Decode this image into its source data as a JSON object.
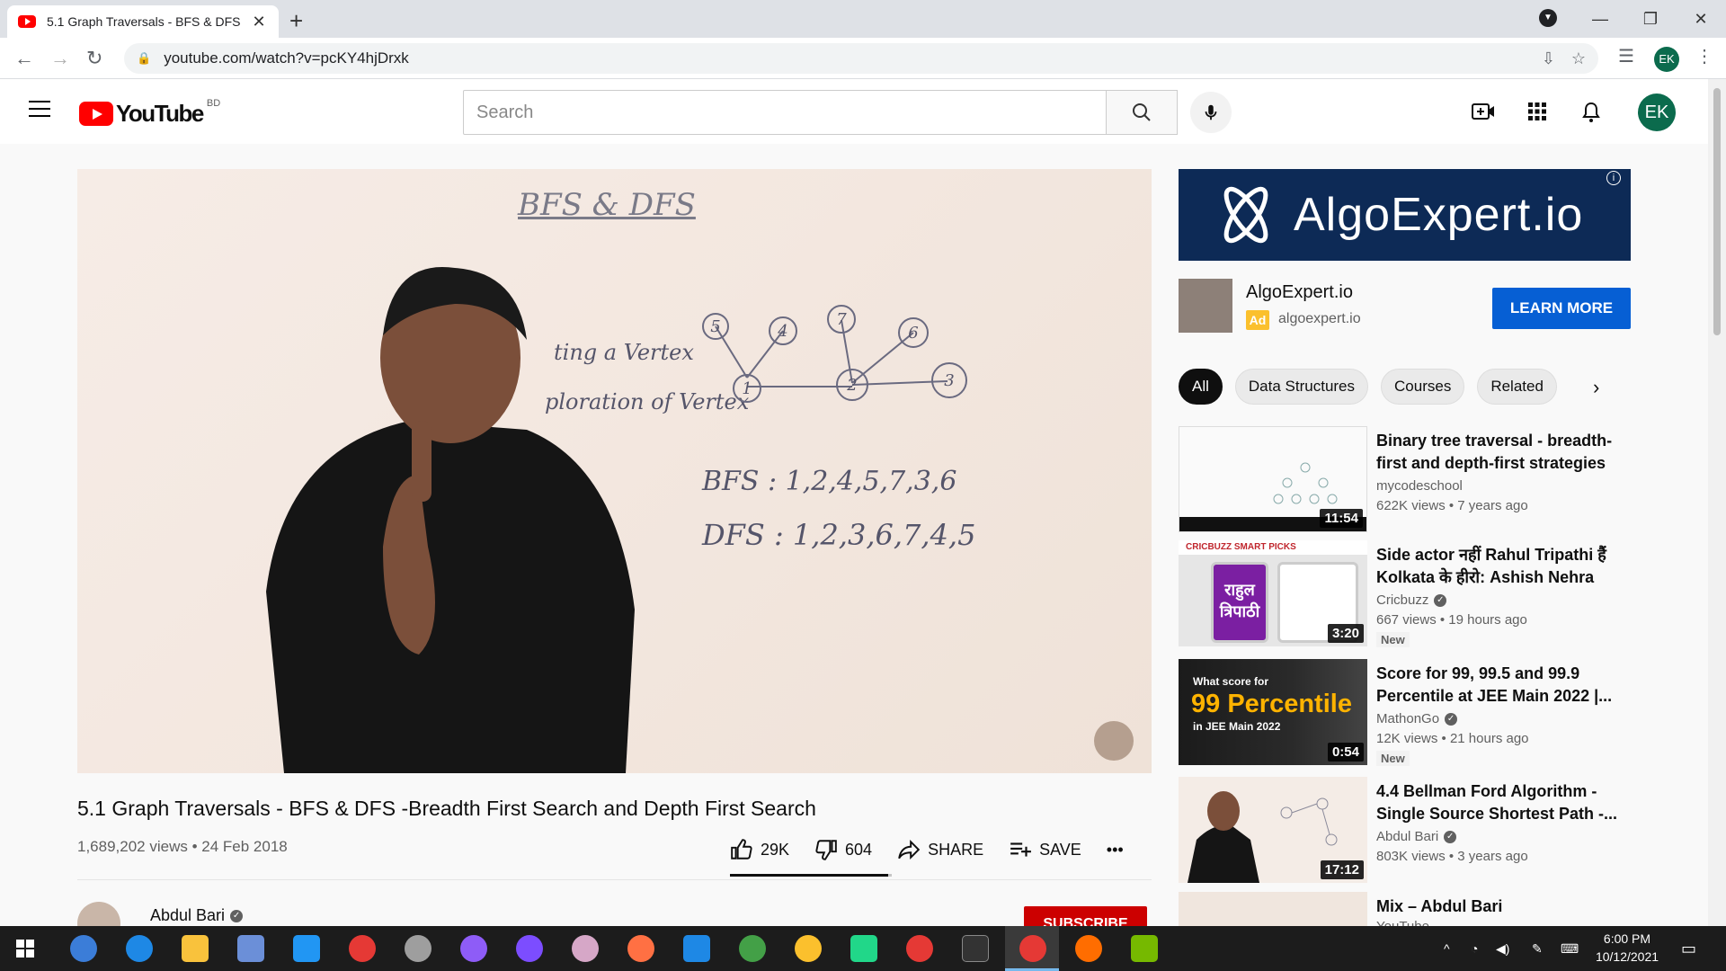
{
  "browser": {
    "tab_title": "5.1 Graph Traversals - BFS & DFS",
    "tab_close": "✕",
    "new_tab": "+",
    "url": "youtube.com/watch?v=pcKY4hjDrxk",
    "profile_initials": "EK",
    "window_controls": [
      "—",
      "❐",
      "✕"
    ]
  },
  "youtube": {
    "logo_text": "YouTube",
    "country_code": "BD",
    "search_placeholder": "Search",
    "user_initials": "EK"
  },
  "video": {
    "board_title": "BFS & DFS",
    "board_lines": [
      "ting a Vertex",
      "ploration of Vertex"
    ],
    "bfs_line": "BFS : 1,2,4,5,7,3,6",
    "dfs_line": "DFS : 1,2,3,6,7,4,5",
    "graph_nodes": [
      "5",
      "4",
      "7",
      "6",
      "1",
      "2",
      "3"
    ],
    "title": "5.1 Graph Traversals - BFS & DFS -Breadth First Search and Depth First Search",
    "views": "1,689,202 views",
    "date": "24 Feb 2018",
    "likes": "29K",
    "dislikes": "604",
    "like_ratio": 0.979,
    "share_label": "SHARE",
    "save_label": "SAVE",
    "more_label": "•••",
    "channel_name": "Abdul Bari",
    "subscribe_label": "SUBSCRIBE"
  },
  "ad": {
    "banner_text": "AlgoExpert.io",
    "title": "AlgoExpert.io",
    "badge": "Ad",
    "url": "algoexpert.io",
    "cta": "LEARN MORE",
    "info": "i"
  },
  "chips": [
    "All",
    "Data Structures",
    "Courses",
    "Related"
  ],
  "recommendations": [
    {
      "title": "Binary tree traversal - breadth-first and depth-first strategies",
      "channel": "mycodeschool",
      "meta": "622K views • 7 years ago",
      "duration": "11:54",
      "verified": false,
      "badge": ""
    },
    {
      "title": "Side actor नहीं Rahul Tripathi हैं Kolkata के हीरो: Ashish Nehra",
      "channel": "Cricbuzz",
      "meta": "667 views • 19 hours ago",
      "duration": "3:20",
      "verified": true,
      "badge": "New"
    },
    {
      "title": "Score for 99, 99.5 and 99.9 Percentile at JEE Main 2022 |...",
      "channel": "MathonGo",
      "meta": "12K views • 21 hours ago",
      "duration": "0:54",
      "verified": true,
      "badge": "New"
    },
    {
      "title": "4.4 Bellman Ford Algorithm - Single Source Shortest Path -...",
      "channel": "Abdul Bari",
      "meta": "803K views • 3 years ago",
      "duration": "17:12",
      "verified": true,
      "badge": ""
    },
    {
      "title": "Mix – Abdul Bari",
      "channel": "YouTube",
      "meta": "",
      "duration": "",
      "verified": false,
      "badge": ""
    }
  ],
  "thumb_text": {
    "t2_brand": "CRICBUZZ SMART PICKS",
    "t2_name": "राहुल त्रिपाठी",
    "t3_line1": "What score for",
    "t3_line2": "99 Percentile",
    "t3_line3": "in JEE Main 2022"
  },
  "taskbar": {
    "time": "6:00 PM",
    "date": "10/12/2021"
  },
  "colors": {
    "youtube_red": "#ff0000",
    "subscribe_red": "#cc0000",
    "learn_more_blue": "#065fd4",
    "ad_banner_navy": "#0d2a56",
    "avatar_green": "#0b6b4d"
  }
}
